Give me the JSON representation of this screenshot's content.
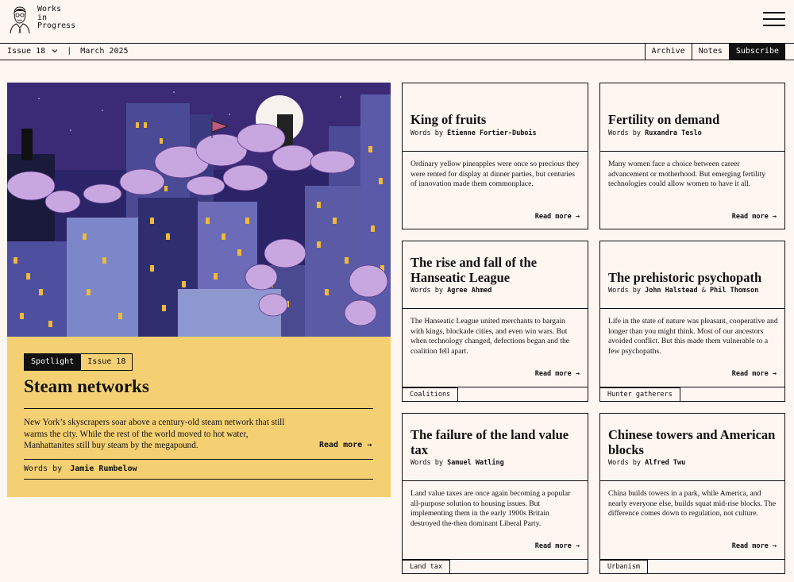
{
  "brand": {
    "line1": "Works",
    "line2": "in",
    "line3": "Progress"
  },
  "issue_bar": {
    "issue": "Issue 18",
    "separator": "|",
    "date": "March 2025",
    "nav": [
      "Archive",
      "Notes",
      "Subscribe"
    ]
  },
  "hero": {
    "tag_primary": "Spotlight",
    "tag_secondary": "Issue 18",
    "title": "Steam networks",
    "description": "New York’s skyscrapers soar above a century-old steam network that still warms the city. While the rest of the world moved to hot water, Manhattanites still buy steam by the megapound.",
    "read_more": "Read more →",
    "byline_prefix": "Words by",
    "author": "Jamie Rumbelow"
  },
  "cards": [
    {
      "title": "King of fruits",
      "byline_prefix": "Words by",
      "author": "Étienne Fortier-Dubois",
      "description": "Ordinary yellow pineapples were once so precious they were rented for display at dinner parties, but centuries of innovation made them commonplace.",
      "read_more": "Read more →"
    },
    {
      "title": "Fertility on demand",
      "byline_prefix": "Words by",
      "author": "Ruxandra Teslo",
      "description": "Many women face a choice between career advancement or motherhood. But emerging fertility technologies could allow women to have it all.",
      "read_more": "Read more →"
    },
    {
      "title": "The rise and fall of the Hanseatic League",
      "byline_prefix": "Words by",
      "author": "Agree Ahmed",
      "description": "The Hanseatic League united merchants to bargain with kings, blockade cities, and even win wars. But when technology changed, defections began and the coalition fell apart.",
      "read_more": "Read more →",
      "tag": "Coalitions"
    },
    {
      "title": "The prehistoric psychopath",
      "byline_prefix": "Words by",
      "author": "John Halstead",
      "amp": "&",
      "author2": "Phil Thomson",
      "description": "Life in the state of nature was pleasant, cooperative and longer than you might think. Most of our ancestors avoided conflict. But this made them vulnerable to a few psychopaths.",
      "read_more": "Read more →",
      "tag": "Hunter gatherers"
    },
    {
      "title": "The failure of the land value tax",
      "byline_prefix": "Words by",
      "author": "Samuel Watling",
      "description": "Land value taxes are once again becoming a popular all-purpose solution to housing issues. But implementing them in the early 1900s Britain destroyed the-then dominant Liberal Party.",
      "read_more": "Read more →",
      "tag": "Land tax"
    },
    {
      "title": "Chinese towers and American blocks",
      "byline_prefix": "Words by",
      "author": "Alfred Twu",
      "description": "China builds towers in a park, while America, and nearly everyone else, builds squat mid-rise blocks. The difference comes down to regulation, not culture.",
      "read_more": "Read more →",
      "tag": "Urbanism"
    }
  ],
  "icons": {
    "logo": "portrait-logo-icon",
    "menu": "hamburger-menu-icon",
    "dropdown": "chevron-down-icon"
  },
  "colors": {
    "background": "#fdf6f1",
    "hero_panel": "#f5d072",
    "ink": "#111111",
    "sky": "#3b2a75",
    "smoke": "#c8a7e0"
  }
}
